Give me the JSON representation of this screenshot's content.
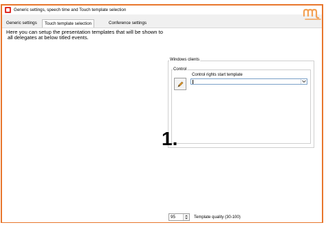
{
  "window": {
    "title": "Generic settings, speech time and Touch template selection",
    "accent_color": "#e8762c"
  },
  "tabs": [
    {
      "label": "Generic settings",
      "active": false
    },
    {
      "label": "Touch template selection",
      "active": true
    },
    {
      "label": "Conference settings",
      "active": false
    }
  ],
  "intro_line1": "Here you can setup the presentation templates that will be shown to",
  "intro_line2": "all delegates at below titled events.",
  "windows_clients": {
    "group_label": "Windows clients",
    "control_label": "Control",
    "field_label": "Control rights start template",
    "select_value": "",
    "edit_icon": "pencil-icon"
  },
  "annotation": "1.",
  "quality": {
    "value": "95",
    "label": "Template quality (30-100)"
  }
}
